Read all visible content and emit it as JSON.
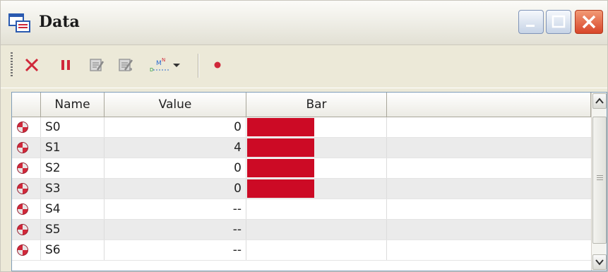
{
  "window": {
    "title": "Data",
    "icon": "data-window-icon",
    "controls": [
      "minimize-icon",
      "maximize-icon",
      "close-icon"
    ]
  },
  "toolbar": {
    "buttons": [
      {
        "icon": "delete-x-icon",
        "color": "#d0283a"
      },
      {
        "icon": "pause-icon",
        "color": "#d0283a"
      },
      {
        "icon": "edit-icon",
        "color": "#9a9a9a"
      },
      {
        "icon": "edit-alt-icon",
        "color": "#9a9a9a"
      },
      {
        "icon": "mn-dropdown-icon",
        "color": "#2a6ad0"
      },
      {
        "icon": "record-dot-icon",
        "color": "#d0283a"
      }
    ]
  },
  "grid": {
    "columns": [
      "Name",
      "Value",
      "Bar"
    ],
    "rows": [
      {
        "name": "S0",
        "value": "0",
        "bar_fraction": 1.0
      },
      {
        "name": "S1",
        "value": "4",
        "bar_fraction": 1.0
      },
      {
        "name": "S2",
        "value": "0",
        "bar_fraction": 1.0
      },
      {
        "name": "S3",
        "value": "0",
        "bar_fraction": 1.0
      },
      {
        "name": "S4",
        "value": "--",
        "bar_fraction": 0
      },
      {
        "name": "S5",
        "value": "--",
        "bar_fraction": 0
      },
      {
        "name": "S6",
        "value": "--",
        "bar_fraction": 0
      }
    ],
    "bar_color": "#cc0a25"
  },
  "scrollbar": {
    "up": "scroll-up-icon",
    "down": "scroll-down-icon"
  }
}
